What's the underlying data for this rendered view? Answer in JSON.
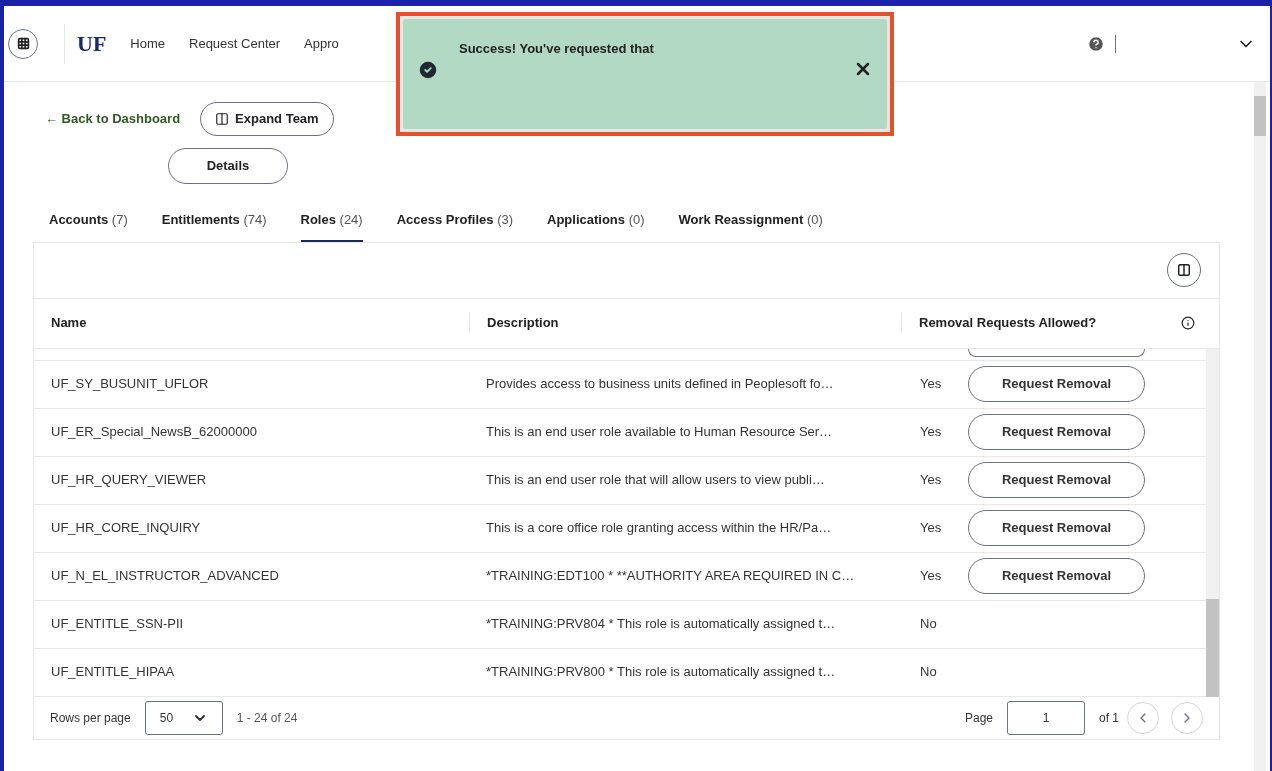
{
  "header": {
    "logo": "UF",
    "nav": [
      "Home",
      "Request Center",
      "Appro"
    ]
  },
  "toast": {
    "message": "Success! You've requested that"
  },
  "back_link": "← Back to Dashboard",
  "expand_button": "Expand Team",
  "details_button": "Details",
  "tabs": [
    {
      "label": "Accounts",
      "count": "(7)",
      "selected": false
    },
    {
      "label": "Entitlements",
      "count": "(74)",
      "selected": false
    },
    {
      "label": "Roles",
      "count": "(24)",
      "selected": true
    },
    {
      "label": "Access Profiles",
      "count": "(3)",
      "selected": false
    },
    {
      "label": "Applications",
      "count": "(0)",
      "selected": false
    },
    {
      "label": "Work Reassignment",
      "count": "(0)",
      "selected": false
    }
  ],
  "table": {
    "columns": [
      "Name",
      "Description",
      "Removal Requests Allowed?"
    ],
    "rows": [
      {
        "name": "UF_SY_BUSUNIT_UFLOR",
        "description": "Provides access to business units defined in Peoplesoft fo…",
        "allowed": "Yes",
        "action": "Request Removal"
      },
      {
        "name": "UF_ER_Special_NewsB_62000000",
        "description": "This is an end user role available to Human Resource Ser…",
        "allowed": "Yes",
        "action": "Request Removal"
      },
      {
        "name": "UF_HR_QUERY_VIEWER",
        "description": "This is an end user role that will allow users to view publi…",
        "allowed": "Yes",
        "action": "Request Removal"
      },
      {
        "name": "UF_HR_CORE_INQUIRY",
        "description": "This is a core office role granting access within the HR/Pa…",
        "allowed": "Yes",
        "action": "Request Removal"
      },
      {
        "name": "UF_N_EL_INSTRUCTOR_ADVANCED",
        "description": "*TRAINING:EDT100 * **AUTHORITY AREA REQUIRED IN C…",
        "allowed": "Yes",
        "action": "Request Removal"
      },
      {
        "name": "UF_ENTITLE_SSN-PII",
        "description": "*TRAINING:PRV804 * This role is automatically assigned t…",
        "allowed": "No"
      },
      {
        "name": "UF_ENTITLE_HIPAA",
        "description": "*TRAINING:PRV800 * This role is automatically assigned t…",
        "allowed": "No"
      }
    ]
  },
  "footer": {
    "rows_label": "Rows per page",
    "rows_value": "50",
    "range": "1 - 24 of 24",
    "page_label": "Page",
    "page_value": "1",
    "page_total": "of 1"
  }
}
